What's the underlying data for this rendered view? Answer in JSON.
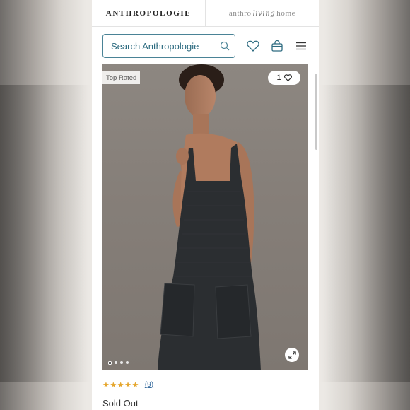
{
  "header": {
    "brand": "ANTHROPOLOGIE",
    "home_brand_prefix": "anthro",
    "home_brand_script": "living",
    "home_brand_suffix": "home"
  },
  "search": {
    "placeholder": "Search Anthropologie",
    "icon": "search-icon"
  },
  "nav_icons": [
    "heart-icon",
    "bag-icon",
    "hamburger-menu-icon"
  ],
  "product": {
    "badge": "Top Rated",
    "like_count": "1",
    "image_dots": 4,
    "active_dot": 0,
    "rating_stars": "★★★★★",
    "review_count": "(9)",
    "availability": "Sold Out"
  },
  "colors": {
    "search_border": "#4a8396",
    "search_text": "#2d6b80",
    "star": "#e5a62d",
    "link": "#3a6ea0"
  }
}
